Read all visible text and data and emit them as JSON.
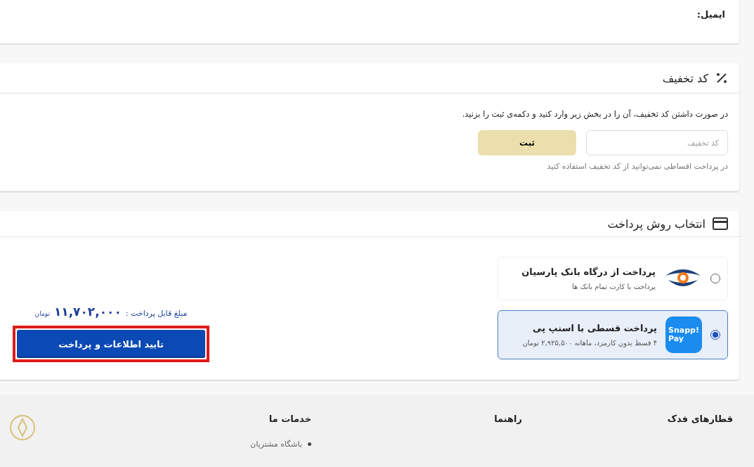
{
  "email_label": "ایمیل:",
  "discount": {
    "title": "کد تخفیف",
    "instruction": "در صورت داشتن کد تخفیف، آن را در بخش زیر وارد کنید و دکمه‌ی ثبت را بزنید.",
    "placeholder": "کد تخفیف",
    "submit": "ثبت",
    "note": "در پرداخت اقساطی نمی‌توانید از کد تخفیف استفاده کنید"
  },
  "payment": {
    "title": "انتخاب روش پرداخت",
    "methods": [
      {
        "kind": "bank",
        "title": "پرداخت از درگاه بانک پارسیان",
        "subtitle": "پرداخت با کارت تمام بانک ها",
        "selected": false
      },
      {
        "kind": "snapp",
        "title": "پرداخت قسطی با اسنپ پی",
        "subtitle": "۴ قسط بدون کارمزد، ماهانه ۲,۹۲۵,۵۰۰ تومان",
        "logo_lines": [
          "Snapp!",
          "Pay"
        ],
        "selected": true
      }
    ],
    "amount_label": "مبلغ قابل پرداخت :",
    "amount": "۱۱,۷۰۲,۰۰۰",
    "currency": "تومان",
    "confirm": "تایید اطلاعات و پرداخت"
  },
  "footer": {
    "columns": [
      {
        "heading": "قطارهای فدک"
      },
      {
        "heading": "راهنما"
      },
      {
        "heading": "خدمات ما",
        "items": [
          "باشگاه مشتریان"
        ]
      }
    ]
  }
}
